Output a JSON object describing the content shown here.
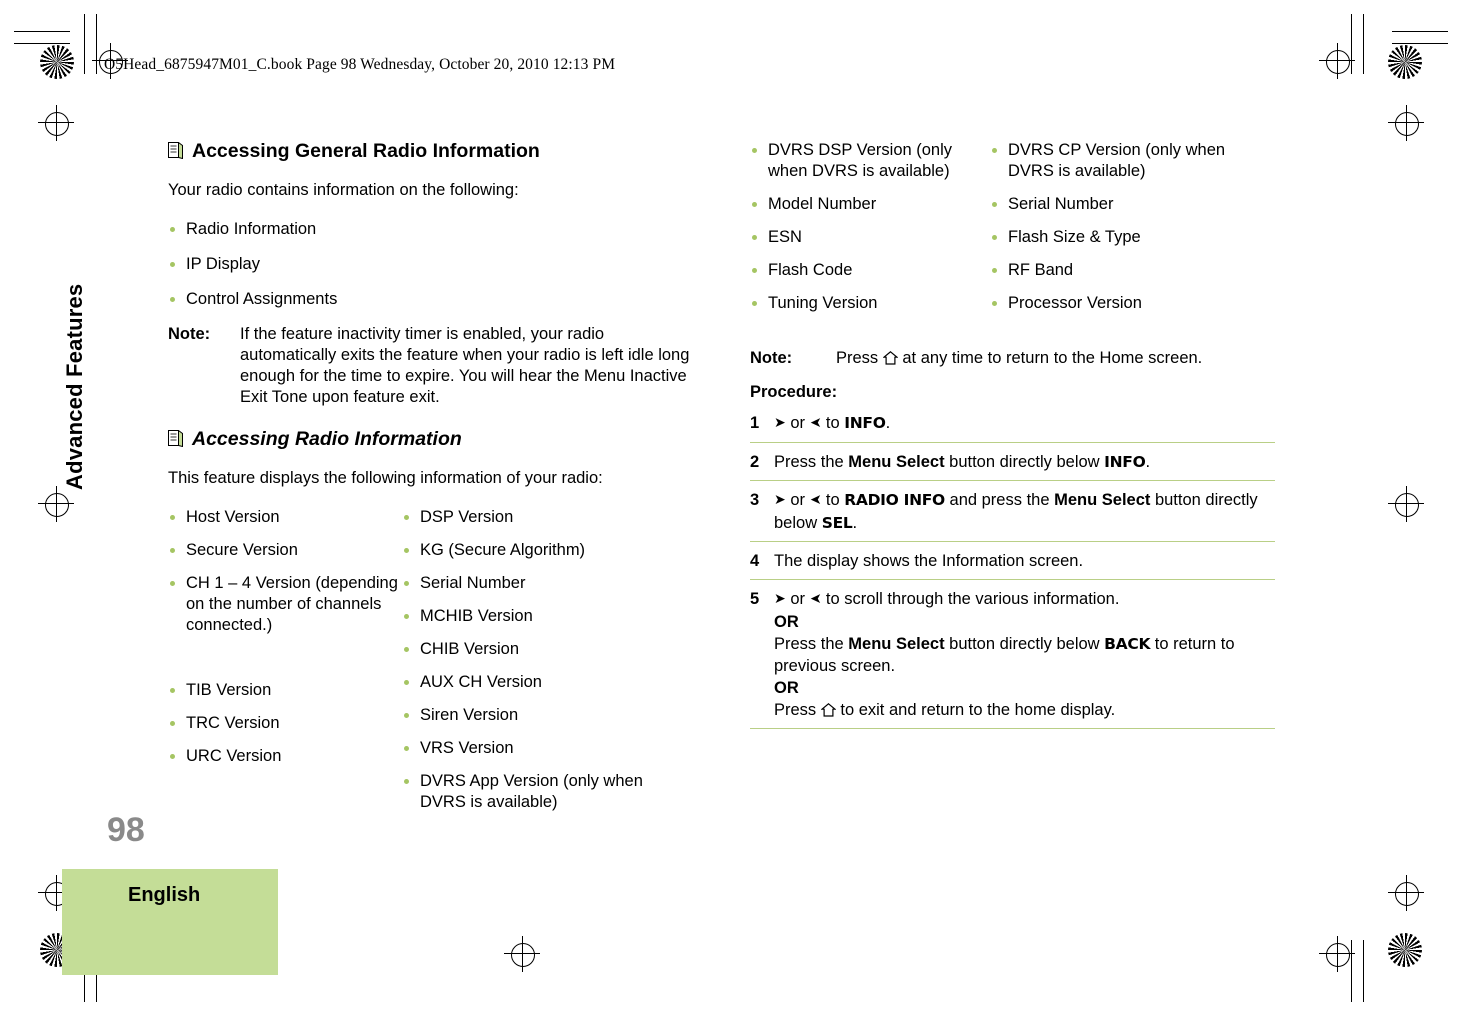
{
  "page": {
    "book_header": "O5Head_6875947M01_C.book  Page 98  Wednesday, October 20, 2010  12:13 PM",
    "side_tab": "Advanced Features",
    "page_number": "98",
    "language": "English",
    "accent_green": "#a5c563",
    "band_green": "#c4dd97",
    "rule_green": "#b9cf86"
  },
  "left_column": {
    "section1": {
      "title": "Accessing General Radio Information",
      "intro": "Your radio contains information on the following:",
      "bullets": [
        "Radio Information",
        "IP Display",
        "Control Assignments"
      ],
      "note_label": "Note:",
      "note_text": "If the feature inactivity timer is enabled, your radio automatically exits the feature when your radio is left idle long enough for the time to expire. You will hear the Menu Inactive Exit Tone upon feature exit."
    },
    "section2": {
      "title": "Accessing Radio Information",
      "intro": "This feature displays the following information of your radio:",
      "column_a": [
        "Host Version",
        "Secure Version",
        "CH 1 – 4 Version (depending on the number of channels connected.)",
        "TIB Version",
        "TRC Version",
        "URC Version"
      ],
      "column_b": [
        "DSP Version",
        "KG (Secure Algorithm)",
        "Serial Number",
        "MCHIB Version",
        "CHIB Version",
        "AUX CH Version",
        "Siren Version",
        "VRS Version",
        "DVRS App Version (only when DVRS is available)"
      ]
    }
  },
  "right_column": {
    "list_a": [
      "DVRS DSP Version (only when DVRS is available)",
      "Model Number",
      "ESN",
      "Flash Code",
      "Tuning Version"
    ],
    "list_b": [
      "DVRS CP Version (only when DVRS is available)",
      "Serial Number",
      "Flash Size & Type",
      "RF Band",
      "Processor Version"
    ],
    "note_label": "Note:",
    "note_text_pre": "Press",
    "note_text_post": "at any time to return to the Home screen.",
    "procedure_label": "Procedure:",
    "steps": [
      {
        "num": "1",
        "parts": [
          {
            "t": "glyph-right"
          },
          {
            "t": "text",
            "v": " or "
          },
          {
            "t": "glyph-left"
          },
          {
            "t": "text",
            "v": " to "
          },
          {
            "t": "lcd",
            "v": "INFO"
          },
          {
            "t": "text",
            "v": "."
          }
        ]
      },
      {
        "num": "2",
        "parts": [
          {
            "t": "text",
            "v": "Press the "
          },
          {
            "t": "bold",
            "v": "Menu Select"
          },
          {
            "t": "text",
            "v": " button directly below "
          },
          {
            "t": "lcd",
            "v": "INFO"
          },
          {
            "t": "text",
            "v": "."
          }
        ]
      },
      {
        "num": "3",
        "parts": [
          {
            "t": "glyph-right"
          },
          {
            "t": "text",
            "v": " or "
          },
          {
            "t": "glyph-left"
          },
          {
            "t": "text",
            "v": " to "
          },
          {
            "t": "lcd",
            "v": "RADIO INFO"
          },
          {
            "t": "text",
            "v": " and press the "
          },
          {
            "t": "bold",
            "v": "Menu Select"
          },
          {
            "t": "text",
            "v": " button directly below "
          },
          {
            "t": "lcd",
            "v": "SEL"
          },
          {
            "t": "text",
            "v": "."
          }
        ]
      },
      {
        "num": "4",
        "parts": [
          {
            "t": "text",
            "v": "The display shows the Information screen."
          }
        ]
      },
      {
        "num": "5",
        "parts": [
          {
            "t": "glyph-right"
          },
          {
            "t": "text",
            "v": " or "
          },
          {
            "t": "glyph-left"
          },
          {
            "t": "text",
            "v": " to scroll through the various information."
          },
          {
            "t": "br"
          },
          {
            "t": "bold",
            "v": "OR"
          },
          {
            "t": "br"
          },
          {
            "t": "text",
            "v": "Press the "
          },
          {
            "t": "bold",
            "v": "Menu Select"
          },
          {
            "t": "text",
            "v": " button directly below "
          },
          {
            "t": "lcd",
            "v": "BACK"
          },
          {
            "t": "text",
            "v": " to return to previous screen."
          },
          {
            "t": "br"
          },
          {
            "t": "bold",
            "v": "OR"
          },
          {
            "t": "br"
          },
          {
            "t": "text",
            "v": "Press "
          },
          {
            "t": "glyph-home"
          },
          {
            "t": "text",
            "v": " to exit and return to the home display."
          }
        ]
      }
    ]
  }
}
